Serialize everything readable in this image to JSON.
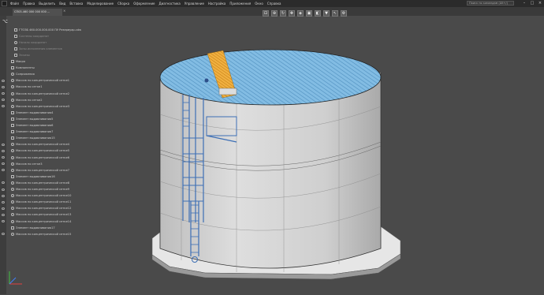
{
  "menubar": {
    "items": [
      "Файл",
      "Правка",
      "Выделить",
      "Вид",
      "Вставка",
      "Моделирование",
      "Сборка",
      "Оформление",
      "Диагностика",
      "Управление",
      "Настройка",
      "Приложения",
      "Окно",
      "Справка"
    ],
    "search_placeholder": "Поиск по командам (Alt+/)"
  },
  "tab": {
    "label": "СП03-460 000 000 000 ..."
  },
  "tree": {
    "rows": [
      {
        "label": "ГТОЗБ 460.000.000.000 ПУ Резервуар.cdw",
        "dim": false,
        "eye": false,
        "icon": "sq"
      },
      {
        "label": "Системы координат",
        "dim": true,
        "eye": false,
        "icon": "sq"
      },
      {
        "label": "Начало координат",
        "dim": true,
        "eye": false,
        "icon": "ci"
      },
      {
        "label": "Зоны исполнения элементов",
        "dim": true,
        "eye": false,
        "icon": "sq"
      },
      {
        "label": "Эскизы",
        "dim": true,
        "eye": false,
        "icon": "sq"
      },
      {
        "label": "Макро",
        "dim": false,
        "eye": false,
        "icon": "sq"
      },
      {
        "label": "Компоненты",
        "dim": false,
        "eye": false,
        "icon": "sq"
      },
      {
        "label": "Сопряжения",
        "dim": false,
        "eye": false,
        "icon": "ci"
      },
      {
        "label": "Массив по концентрической сетке1",
        "dim": false,
        "eye": true,
        "icon": "ci"
      },
      {
        "label": "Массив по сетке1",
        "dim": false,
        "eye": true,
        "icon": "ci"
      },
      {
        "label": "Массив по концентрической сетке2",
        "dim": false,
        "eye": true,
        "icon": "ci"
      },
      {
        "label": "Массив по сетке2",
        "dim": false,
        "eye": true,
        "icon": "ci"
      },
      {
        "label": "Массив по концентрической сетке3",
        "dim": false,
        "eye": true,
        "icon": "ci"
      },
      {
        "label": "Элемент выдавливания4",
        "dim": false,
        "eye": false,
        "icon": "sq"
      },
      {
        "label": "Элемент выдавливания5",
        "dim": false,
        "eye": false,
        "icon": "sq"
      },
      {
        "label": "Элемент выдавливания6",
        "dim": false,
        "eye": false,
        "icon": "sq"
      },
      {
        "label": "Элемент выдавливания7",
        "dim": false,
        "eye": false,
        "icon": "sq"
      },
      {
        "label": "Элемент выдавливания15",
        "dim": false,
        "eye": false,
        "icon": "sq"
      },
      {
        "label": "Массив по концентрической сетке4",
        "dim": false,
        "eye": true,
        "icon": "ci"
      },
      {
        "label": "Массив по концентрической сетке5",
        "dim": false,
        "eye": true,
        "icon": "ci"
      },
      {
        "label": "Массив по концентрической сетке6",
        "dim": false,
        "eye": true,
        "icon": "ci"
      },
      {
        "label": "Массив по сетке3",
        "dim": false,
        "eye": true,
        "icon": "ci"
      },
      {
        "label": "Массив по концентрической сетке7",
        "dim": false,
        "eye": true,
        "icon": "ci"
      },
      {
        "label": "Элемент выдавливания16",
        "dim": false,
        "eye": false,
        "icon": "sq"
      },
      {
        "label": "Массив по концентрической сетке8",
        "dim": false,
        "eye": true,
        "icon": "ci"
      },
      {
        "label": "Массив по концентрической сетке9",
        "dim": false,
        "eye": true,
        "icon": "ci"
      },
      {
        "label": "Массив по концентрической сетке10",
        "dim": false,
        "eye": true,
        "icon": "ci"
      },
      {
        "label": "Массив по концентрической сетке11",
        "dim": false,
        "eye": true,
        "icon": "ci"
      },
      {
        "label": "Массив по концентрической сетке12",
        "dim": false,
        "eye": true,
        "icon": "ci"
      },
      {
        "label": "Массив по концентрической сетке13",
        "dim": false,
        "eye": true,
        "icon": "ci"
      },
      {
        "label": "Массив по концентрической сетке14",
        "dim": false,
        "eye": true,
        "icon": "ci"
      },
      {
        "label": "Элемент выдавливания17",
        "dim": false,
        "eye": false,
        "icon": "sq"
      },
      {
        "label": "Массив по концентрической сетке15",
        "dim": false,
        "eye": true,
        "icon": "ci"
      }
    ]
  },
  "colors": {
    "roof": "#7ab3dc",
    "stair": "#e8a020",
    "ladder": "#3d6fb5",
    "shell": "#d8d8d8"
  }
}
